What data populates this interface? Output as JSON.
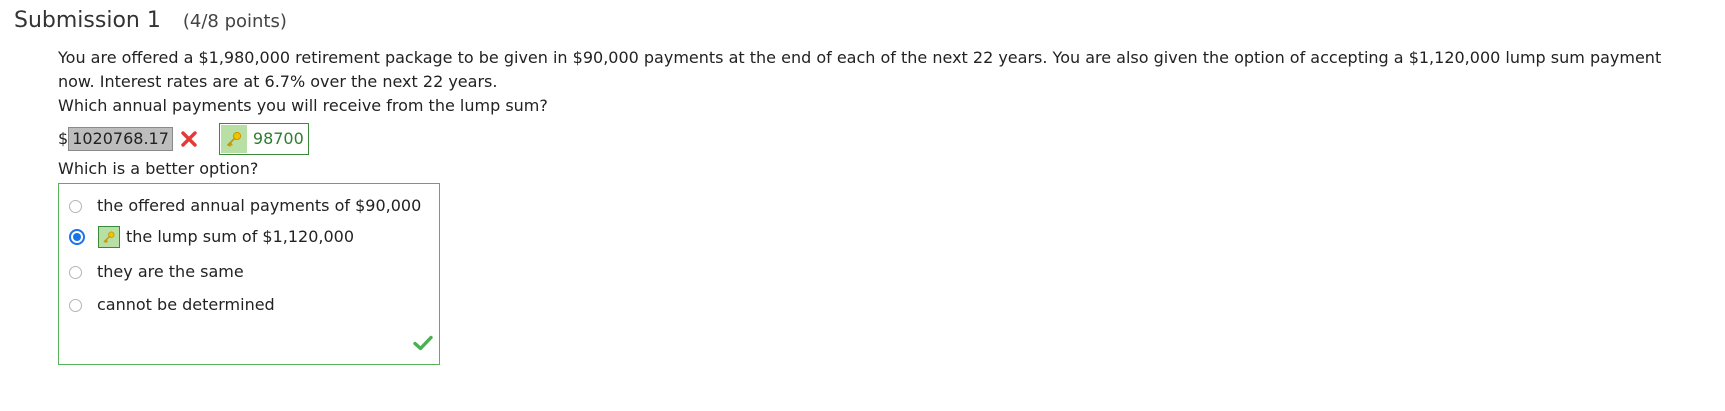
{
  "header": {
    "title": "Submission 1",
    "points": "(4/8 points)"
  },
  "question": {
    "text_line1": "You are offered a $1,980,000 retirement package to be given in $90,000 payments at the end of each of the next 22 years. You are also given the option of accepting a $1,120,000 lump sum payment",
    "text_line2": "now. Interest rates are at 6.7% over the next 22 years.",
    "part1_prompt": "Which annual payments you will receive from the lump sum?",
    "currency_symbol": "$",
    "part1_answer": "1020768.17",
    "part1_correct_answer": "98700",
    "part1_status": "incorrect",
    "part2_prompt": "Which is a better option?",
    "part2_status": "correct",
    "choices": [
      {
        "label": "the offered annual payments of $90,000",
        "selected": false,
        "key": false
      },
      {
        "label": "the lump sum of $1,120,000",
        "selected": true,
        "key": true
      },
      {
        "label": "they are the same",
        "selected": false,
        "key": false
      },
      {
        "label": "cannot be determined",
        "selected": false,
        "key": false
      }
    ]
  },
  "icons": {
    "incorrect": "x-mark-icon",
    "key": "key-icon",
    "correct": "check-mark-icon"
  },
  "colors": {
    "incorrect_red": "#e53935",
    "correct_green": "#4caf50",
    "key_background": "#b8dfa4",
    "radio_selected": "#1a73e8",
    "answer_input_bg": "#bdbdbd"
  }
}
